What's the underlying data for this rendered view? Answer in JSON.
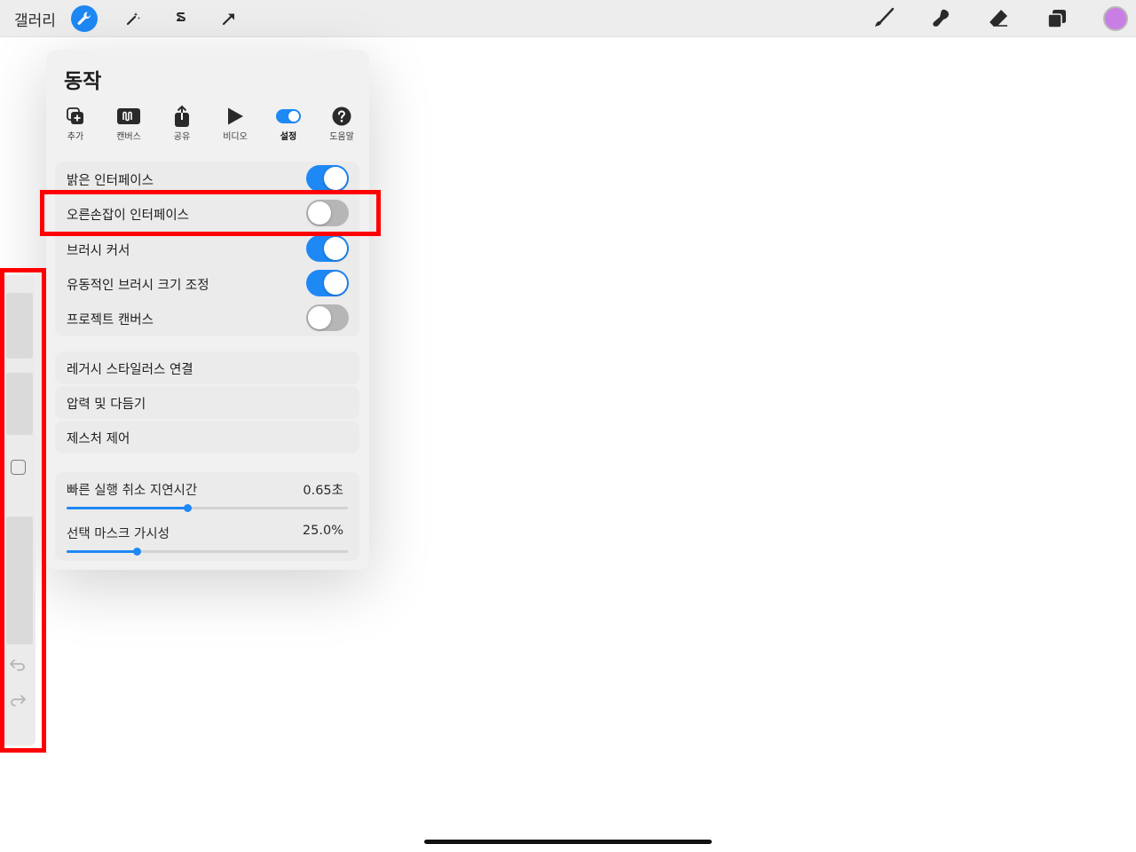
{
  "toolbar": {
    "gallery_label": "갤러리",
    "left_icons": [
      "wrench-icon",
      "magic-wand-icon",
      "selection-icon",
      "transform-arrow-icon"
    ],
    "right_icons": [
      "brush-icon",
      "smudge-icon",
      "eraser-icon",
      "layers-icon"
    ],
    "current_color": "#c97ee6"
  },
  "actions_panel": {
    "title": "동작",
    "tabs": [
      {
        "label": "추가",
        "icon": "add-icon"
      },
      {
        "label": "캔버스",
        "icon": "canvas-icon"
      },
      {
        "label": "공유",
        "icon": "share-icon"
      },
      {
        "label": "비디오",
        "icon": "video-play-icon"
      },
      {
        "label": "설정",
        "icon": "settings-toggle-icon",
        "selected": true
      },
      {
        "label": "도움말",
        "icon": "help-icon"
      }
    ],
    "toggles": [
      {
        "label": "밝은 인터페이스",
        "on": true
      },
      {
        "label": "오른손잡이 인터페이스",
        "on": false
      },
      {
        "label": "브러시 커서",
        "on": true
      },
      {
        "label": "유동적인 브러시 크기 조정",
        "on": true
      },
      {
        "label": "프로젝트 캔버스",
        "on": false
      }
    ],
    "menu_items": [
      "레거시 스타일러스 연결",
      "압력 및 다듬기",
      "제스처 제어"
    ],
    "sliders": [
      {
        "label": "빠른 실행 취소 지연시간",
        "value": "0.65초",
        "fraction": 0.43
      },
      {
        "label": "선택 마스크 가시성",
        "value": "25.0%",
        "fraction": 0.25
      }
    ]
  },
  "colors": {
    "accent": "#1e88f5",
    "highlight": "#ff0000"
  }
}
